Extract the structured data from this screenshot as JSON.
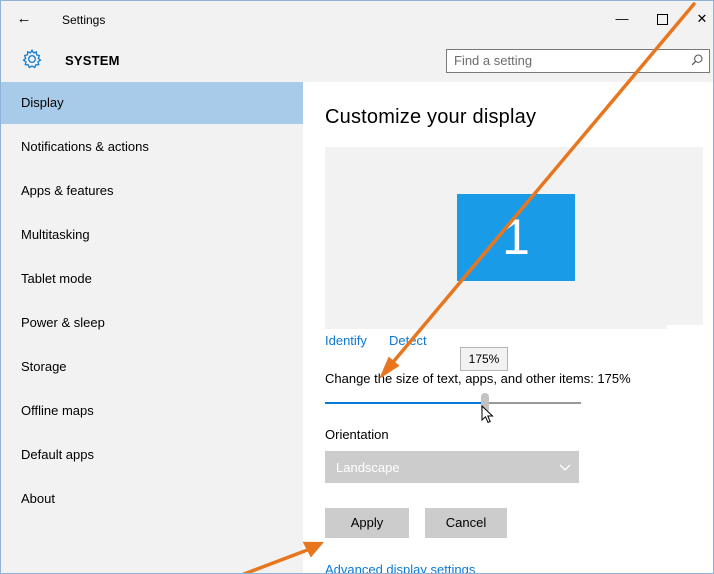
{
  "window": {
    "title": "Settings",
    "back_glyph": "←",
    "minimize_glyph": "—",
    "close_glyph": "✕"
  },
  "header": {
    "section_title": "SYSTEM",
    "icon": "gear-icon",
    "search_placeholder": "Find a setting"
  },
  "sidebar": {
    "items": [
      {
        "label": "Display",
        "active": true
      },
      {
        "label": "Notifications & actions"
      },
      {
        "label": "Apps & features"
      },
      {
        "label": "Multitasking"
      },
      {
        "label": "Tablet mode"
      },
      {
        "label": "Power & sleep"
      },
      {
        "label": "Storage"
      },
      {
        "label": "Offline maps"
      },
      {
        "label": "Default apps"
      },
      {
        "label": "About"
      }
    ]
  },
  "main": {
    "title": "Customize your display",
    "monitor_number": "1",
    "identify_link": "Identify",
    "detect_link": "Detect",
    "tooltip": "175%",
    "scale_label": "Change the size of text, apps, and other items: 175%",
    "scale_slider_fraction": 0.63,
    "orientation_label": "Orientation",
    "orientation_value": "Landscape",
    "apply_label": "Apply",
    "cancel_label": "Cancel",
    "advanced_link": "Advanced display settings"
  },
  "colors": {
    "accent": "#0a78d7",
    "monitor": "#1a9be8",
    "nav_active": "#a7cbe9",
    "annotation_arrow": "#e8761e"
  }
}
